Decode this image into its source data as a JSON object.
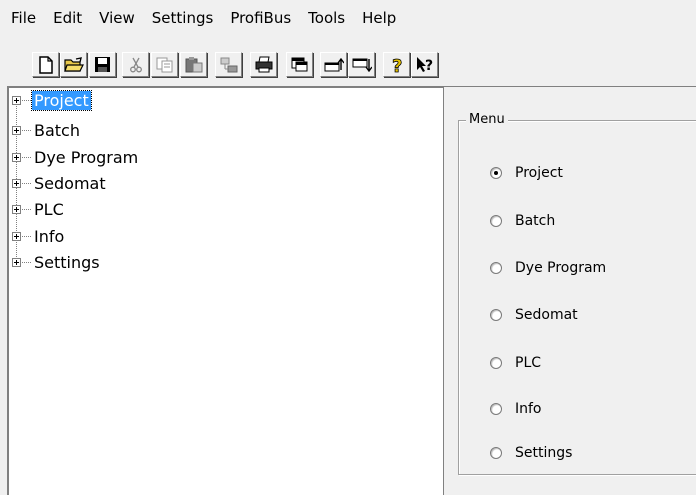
{
  "menubar": {
    "items": [
      "File",
      "Edit",
      "View",
      "Settings",
      "ProfiBus",
      "Tools",
      "Help"
    ]
  },
  "toolbar": {
    "buttons": [
      "new-document",
      "open-folder",
      "save",
      "cut",
      "copy",
      "paste",
      "network",
      "print",
      "window",
      "move-up",
      "move-down",
      "help",
      "context-help"
    ]
  },
  "tree": {
    "items": [
      {
        "label": "Project",
        "selected": true
      },
      {
        "label": "Batch",
        "selected": false
      },
      {
        "label": "Dye Program",
        "selected": false
      },
      {
        "label": "Sedomat",
        "selected": false
      },
      {
        "label": "PLC",
        "selected": false
      },
      {
        "label": "Info",
        "selected": false
      },
      {
        "label": "Settings",
        "selected": false
      }
    ]
  },
  "menu_group": {
    "title": "Menu",
    "options": [
      {
        "label": "Project",
        "checked": true
      },
      {
        "label": "Batch",
        "checked": false
      },
      {
        "label": "Dye Program",
        "checked": false
      },
      {
        "label": "Sedomat",
        "checked": false
      },
      {
        "label": "PLC",
        "checked": false
      },
      {
        "label": "Info",
        "checked": false
      },
      {
        "label": "Settings",
        "checked": false
      }
    ]
  },
  "colors": {
    "selection": "#3399ff",
    "window_bg": "#f0f0f0"
  }
}
